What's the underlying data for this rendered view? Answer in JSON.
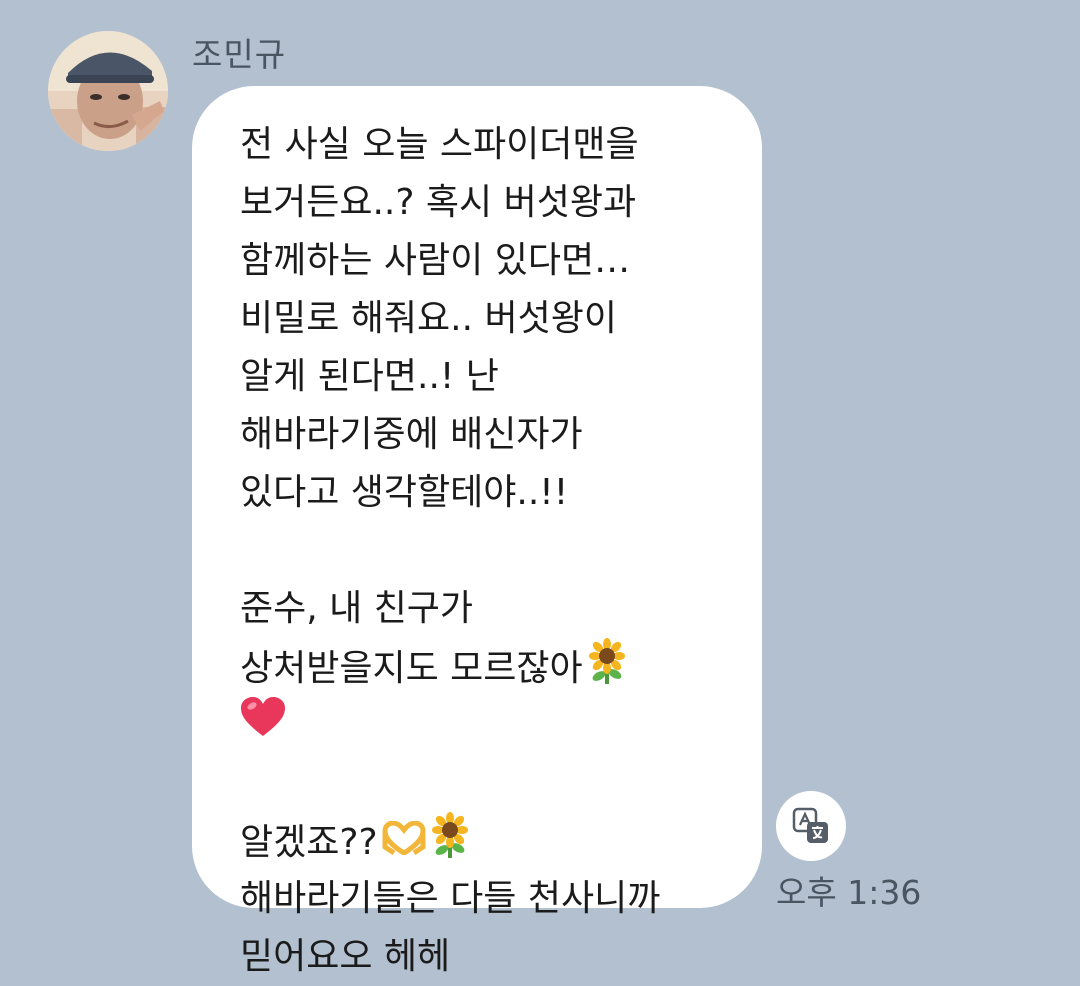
{
  "sender": {
    "name": "조민규",
    "avatar_icon": "profile-photo"
  },
  "message": {
    "lines": [
      "전 사실 오늘 스파이더맨을",
      "보거든요..?  혹시 버섯왕과",
      "함께하는 사람이 있다면…",
      "비밀로 해줘요.. 버섯왕이",
      "알게 된다면..! 난",
      "해바라기중에 배신자가",
      "있다고 생각할테야..!!",
      "",
      "준수, 내 친구가",
      "상처받을지도 모르잖아",
      "",
      "",
      "알겠죠??",
      "해바라기들은 다들 천사니까",
      "믿어요오 헤헤"
    ],
    "emojis": [
      "sunflower",
      "red-heart",
      "heart-hands",
      "sunflower"
    ],
    "bubble_color": "#ffffff",
    "background_color": "#b2c0d0"
  },
  "translate_button": {
    "icon": "translate-icon"
  },
  "timestamp": "오후 1:36"
}
